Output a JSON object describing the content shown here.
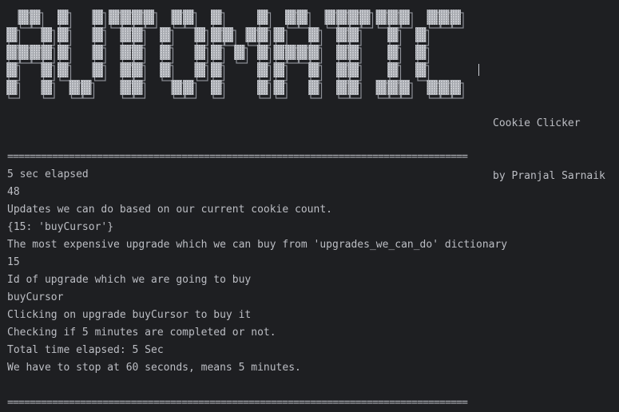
{
  "banner": {
    "logo_text": "AUTOMATIC",
    "title_line": "Cookie Clicker",
    "author_line": "by Pranjal Sarnaik"
  },
  "output": {
    "separator": "==================================================================================",
    "lines": [
      "5 sec elapsed",
      "48",
      "Updates we can do based on our current cookie count.",
      "{15: 'buyCursor'}",
      "The most expensive upgrade which we can buy from 'upgrades_we_can_do' dictionary",
      "15",
      "Id of upgrade which we are going to buy",
      "buyCursor",
      "Clicking on upgrade buyCursor to buy it",
      "Checking if 5 minutes are completed or not.",
      "Total time elapsed: 5 Sec",
      "We have to stop at 60 seconds, means 5 minutes."
    ],
    "separator_bottom": "=================================================================================="
  },
  "colors": {
    "background": "#1e1f22",
    "text": "#bcbec4",
    "logo_fill": "#c9cbd0",
    "logo_shadow": "#8d9097"
  }
}
